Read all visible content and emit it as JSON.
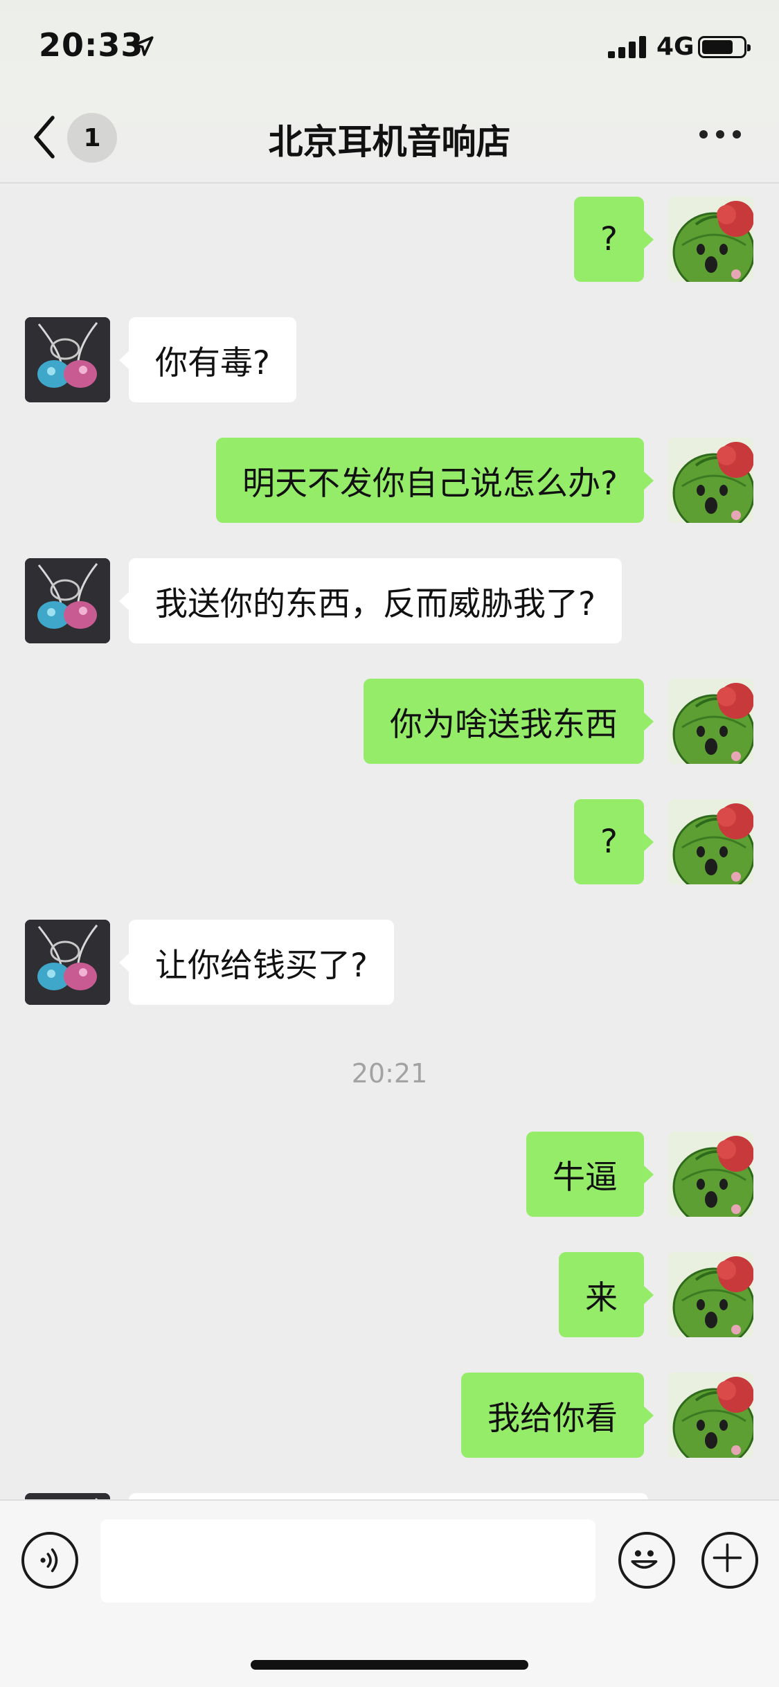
{
  "status_bar": {
    "time": "20:33",
    "network": "4G"
  },
  "header": {
    "unread_count": "1",
    "title": "北京耳机音响店"
  },
  "messages": [
    {
      "side": "me",
      "text": "?"
    },
    {
      "side": "them",
      "text": "你有毒?"
    },
    {
      "side": "me",
      "text": "明天不发你自己说怎么办?"
    },
    {
      "side": "them",
      "text": "我送你的东西，反而威胁我了?"
    },
    {
      "side": "me",
      "text": "你为啥送我东西"
    },
    {
      "side": "me",
      "text": "?"
    },
    {
      "side": "them",
      "text": "让你给钱买了?"
    },
    {
      "side": "me",
      "text": "牛逼"
    },
    {
      "side": "me",
      "text": "来"
    },
    {
      "side": "me",
      "text": "我给你看"
    }
  ],
  "timestamp": "20:21",
  "input": {
    "value": ""
  },
  "icons": [
    "back-chevron-icon",
    "more-dots-icon",
    "voice-icon",
    "emoji-icon",
    "plus-icon",
    "location-arrow-icon",
    "signal-icon",
    "battery-icon"
  ],
  "colors": {
    "my_bubble": "#95ec69",
    "their_bubble": "#ffffff",
    "background": "#ededed"
  }
}
